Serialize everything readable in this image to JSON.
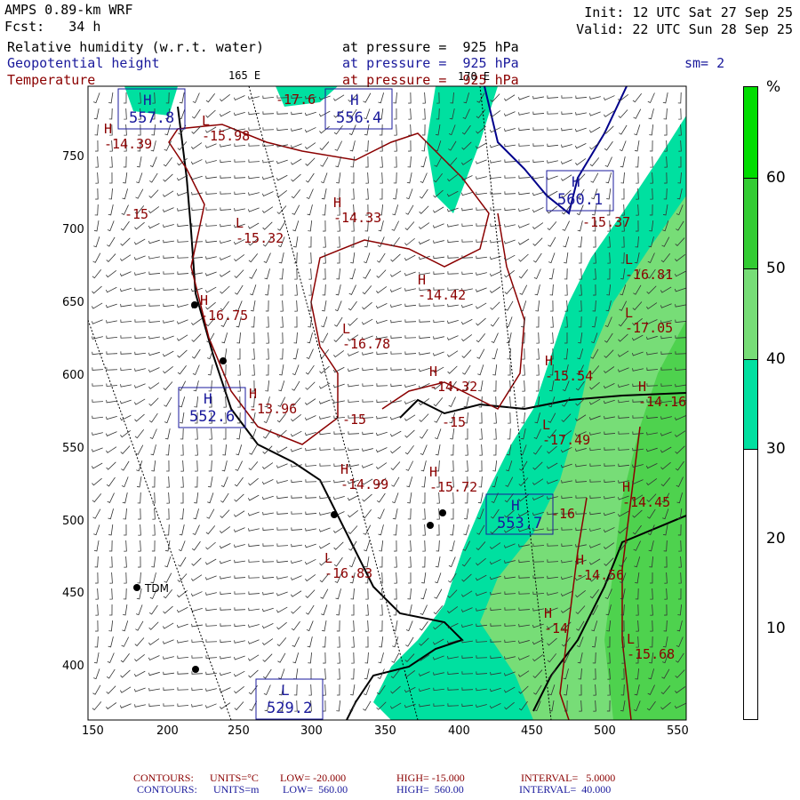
{
  "header": {
    "model": "AMPS 0.89-km WRF",
    "forecast": "Fcst:   34 h",
    "init": "Init: 12 UTC Sat 27 Sep 25",
    "valid": "Valid: 22 UTC Sun 28 Sep 25",
    "fields": [
      {
        "name": "Relative humidity (w.r.t. water)",
        "level": "at pressure =  925 hPa"
      },
      {
        "name": "Geopotential height",
        "level": "at pressure =  925 hPa"
      },
      {
        "name": "Temperature",
        "level": "at pressure =  925 hPa"
      }
    ],
    "smoothing": "sm= 2",
    "lon_labels": [
      "165 E",
      "170 E"
    ]
  },
  "colorbar": {
    "unit": "%",
    "labels": [
      "60",
      "50",
      "40",
      "30",
      "20",
      "10"
    ],
    "colors": [
      "#00dd00",
      "#33cc33",
      "#77dd77",
      "#00e0a0",
      "#ffffff",
      "#ffffff"
    ]
  },
  "axes": {
    "x_ticks": [
      "150",
      "200",
      "250",
      "300",
      "350",
      "400",
      "450",
      "500",
      "550"
    ],
    "y_ticks": [
      "750",
      "700",
      "650",
      "600",
      "550",
      "500",
      "450",
      "400"
    ]
  },
  "map": {
    "station": "TDM",
    "temperature_labels": [
      "-14.39",
      "-15.98",
      "-15",
      "-15.32",
      "-14.33",
      "-14.42",
      "-16.78",
      "-14.32",
      "-16.75",
      "-13.96",
      "-15",
      "-15",
      "-14.99",
      "-15.72",
      "-16.83",
      "-15.37",
      "-16.81",
      "-17.05",
      "-15.54",
      "-14.16",
      "-17.49",
      "-14.45",
      "-16",
      "-14.56",
      "-14",
      "-15.68",
      "-17.6"
    ],
    "height_labels": [
      "557.8",
      "556.4",
      "560.1",
      "552.6",
      "553.7",
      "529.2"
    ],
    "marker_letters": {
      "high": "H",
      "low": "L"
    }
  },
  "footer": {
    "temp": {
      "contours": "CONTOURS:",
      "units": "UNITS=°C",
      "low": "LOW= -20.000",
      "high": "HIGH= -15.000",
      "interval": "INTERVAL=   5.0000"
    },
    "height": {
      "contours": "CONTOURS:",
      "units": "UNITS=m",
      "low": "LOW=  560.00",
      "high": "HIGH=  560.00",
      "interval": "INTERVAL=  40.000"
    }
  },
  "colors": {
    "temperature": "#8b0000",
    "height": "#1a1a9c",
    "rh30": "#00e0a0",
    "rh40": "#77dd77",
    "rh50": "#33cc33",
    "rh60": "#00dd00"
  }
}
